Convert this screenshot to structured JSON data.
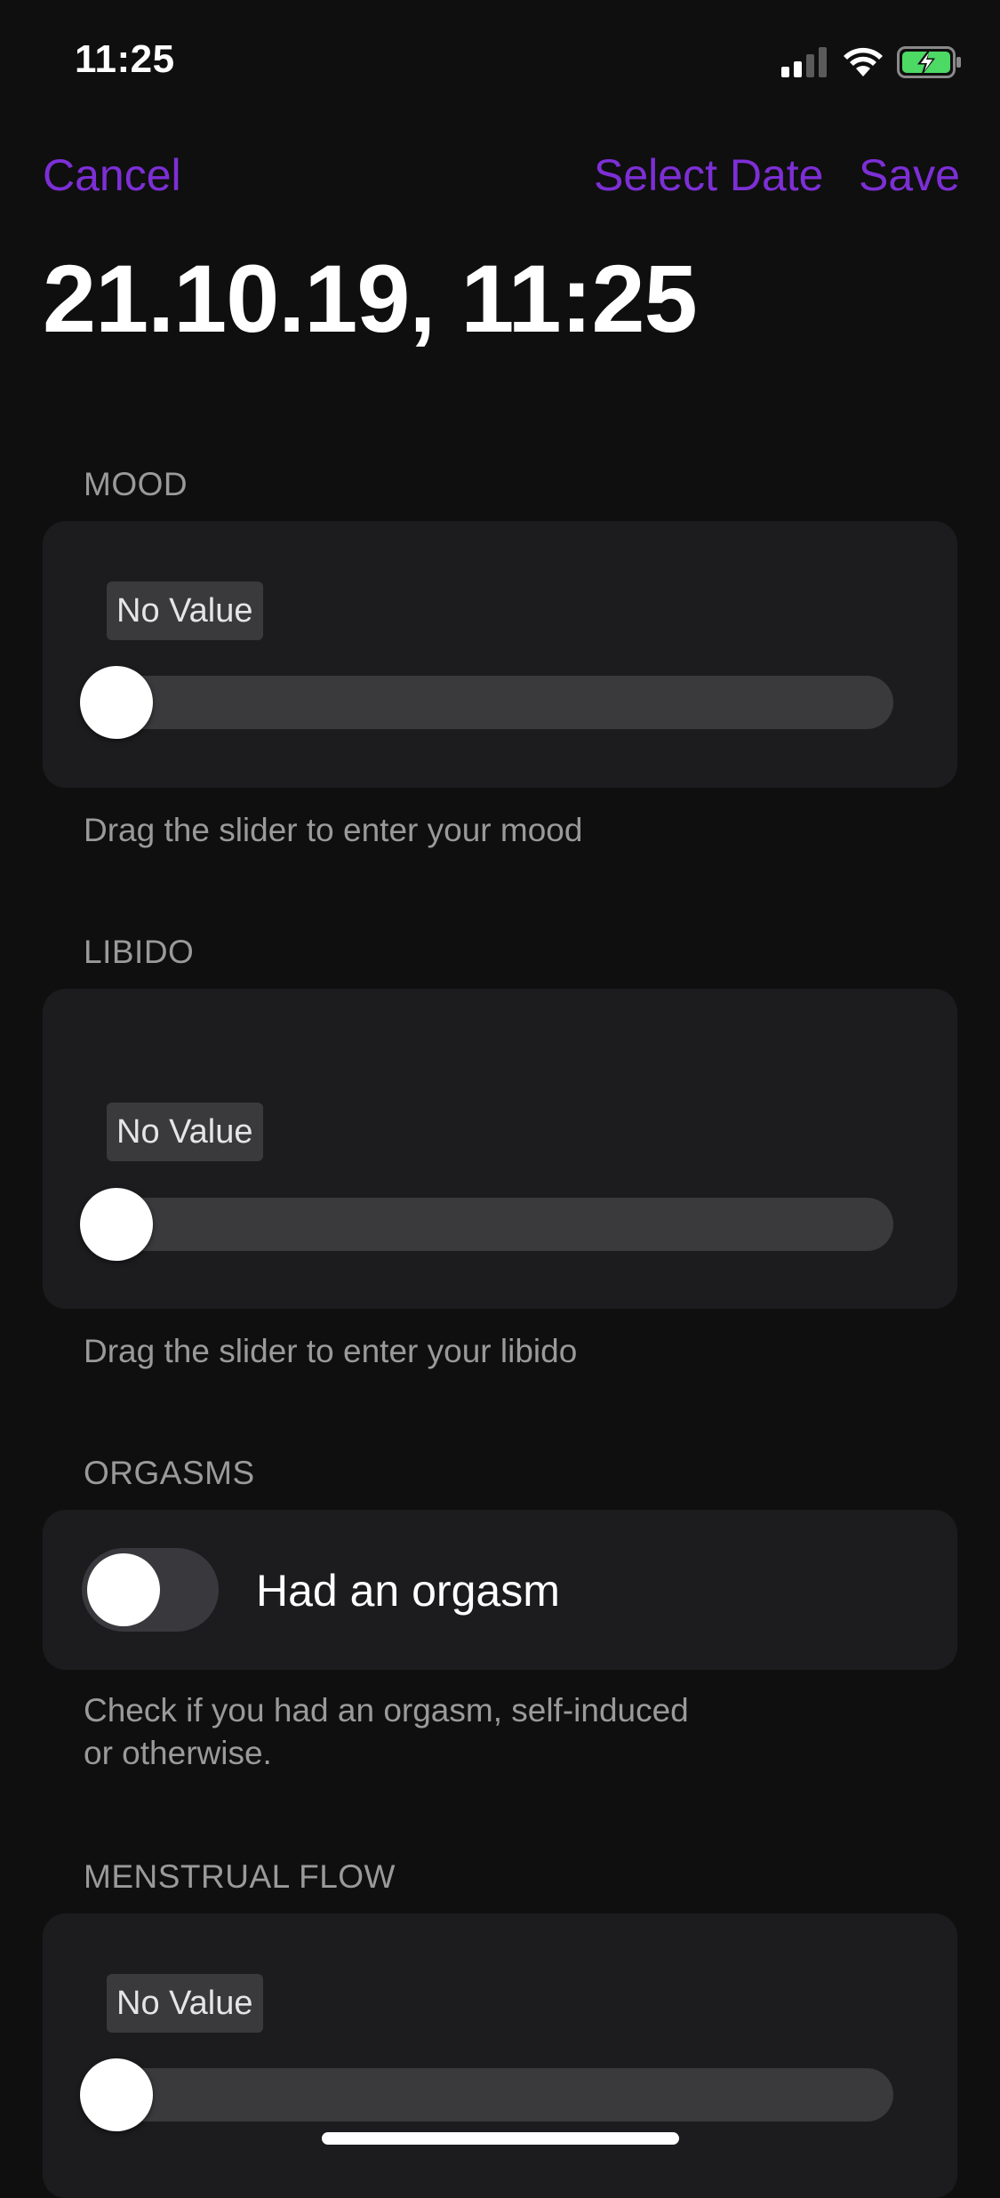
{
  "status_bar": {
    "time": "11:25",
    "icons": [
      "cellular-signal-icon",
      "wifi-icon",
      "battery-charging-icon"
    ]
  },
  "nav": {
    "cancel": "Cancel",
    "select_date": "Select Date",
    "save": "Save",
    "accent_color": "#7d2fd6"
  },
  "title": "21.10.19, 11:25",
  "sections": {
    "mood": {
      "header": "MOOD",
      "value_badge": "No Value",
      "slider_value": 0,
      "footer": "Drag the slider to enter your mood"
    },
    "libido": {
      "header": "LIBIDO",
      "value_badge": "No Value",
      "slider_value": 0,
      "footer": "Drag the slider to enter your libido"
    },
    "orgasms": {
      "header": "ORGASMS",
      "toggle_label": "Had an orgasm",
      "toggle_on": false,
      "footer_line1": "Check if you had an orgasm, self-induced",
      "footer_line2": "or otherwise."
    },
    "menstrual_flow": {
      "header": "MENSTRUAL FLOW",
      "value_badge": "No Value",
      "slider_value": 0
    }
  }
}
